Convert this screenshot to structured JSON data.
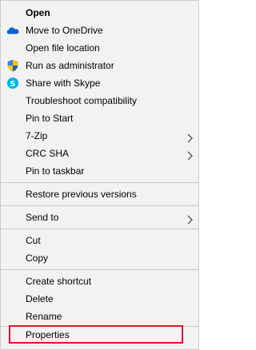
{
  "menu": {
    "items": [
      {
        "label": "Open"
      },
      {
        "label": "Move to OneDrive",
        "icon": "onedrive-cloud-icon"
      },
      {
        "label": "Open file location"
      },
      {
        "label": "Run as administrator",
        "icon": "uac-shield-icon"
      },
      {
        "label": "Share with Skype",
        "icon": "skype-icon"
      },
      {
        "label": "Troubleshoot compatibility"
      },
      {
        "label": "Pin to Start"
      },
      {
        "label": "7-Zip",
        "icon": "chevron-right-icon"
      },
      {
        "label": "CRC SHA",
        "icon": "chevron-right-icon"
      },
      {
        "label": "Pin to taskbar"
      },
      {
        "label": "Restore previous versions"
      },
      {
        "label": "Send to",
        "icon": "chevron-right-icon"
      },
      {
        "label": "Cut"
      },
      {
        "label": "Copy"
      },
      {
        "label": "Create shortcut"
      },
      {
        "label": "Delete"
      },
      {
        "label": "Rename"
      },
      {
        "label": "Properties"
      }
    ]
  },
  "colors": {
    "menu_background": "#f2f2f2",
    "separator": "#c8c8c8",
    "highlight_border": "#d71a2c",
    "onedrive_blue": "#0a64d2",
    "shield_blue": "#1f5fbf",
    "shield_yellow": "#f5c400",
    "skype_blue": "#00aff0"
  }
}
